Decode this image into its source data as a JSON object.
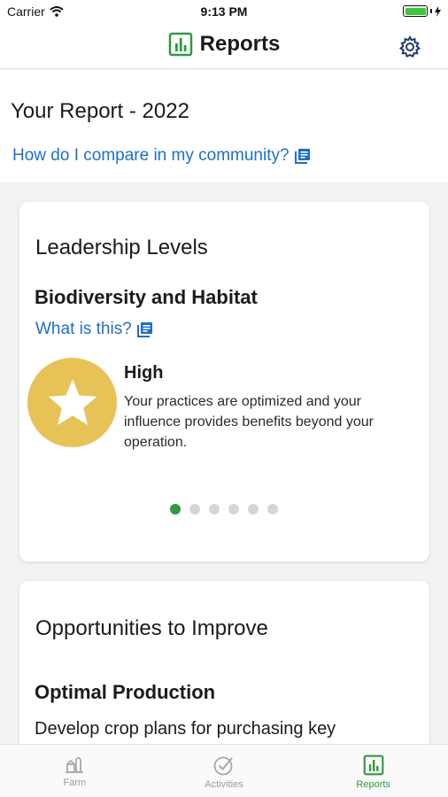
{
  "status_bar": {
    "carrier": "Carrier",
    "time": "9:13 PM"
  },
  "nav": {
    "title": "Reports",
    "icon": "bar-chart-icon",
    "settings_icon": "gear-icon",
    "accent_color": "#2f9a3f"
  },
  "header": {
    "title": "Your Report - 2022",
    "compare_link": "How do I compare in my community?"
  },
  "leadership_card": {
    "heading": "Leadership Levels",
    "category": "Biodiversity and Habitat",
    "what_link": "What is this?",
    "level": {
      "title": "High",
      "description": "Your practices are optimized and your influence provides benefits beyond your operation.",
      "badge_color": "#e7c257",
      "badge_icon": "star-icon"
    },
    "pagination": {
      "total": 6,
      "active": 1
    }
  },
  "improve_card": {
    "heading": "Opportunities to Improve",
    "subheading": "Optimal Production",
    "body": "Develop crop plans for purchasing key"
  },
  "tab_bar": {
    "items": [
      {
        "label": "Farm",
        "icon": "farm-icon",
        "active": false
      },
      {
        "label": "Activities",
        "icon": "check-circle-icon",
        "active": false
      },
      {
        "label": "Reports",
        "icon": "bar-chart-icon",
        "active": true
      }
    ]
  }
}
